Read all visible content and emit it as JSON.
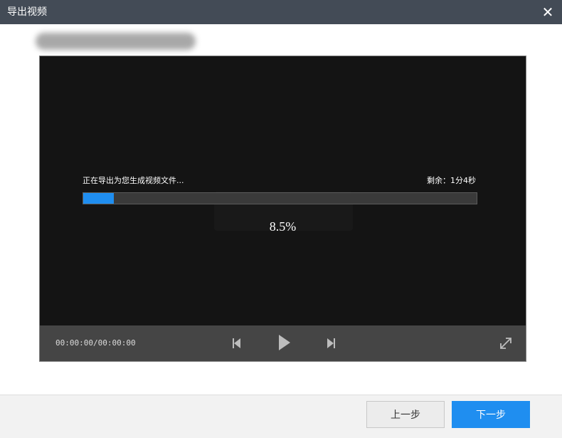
{
  "window": {
    "title": "导出视频"
  },
  "file": {
    "name": ""
  },
  "export": {
    "status_text": "正在导出为您生成视频文件...",
    "remaining_text": "剩余：1分4秒",
    "progress_fraction": 0.077,
    "percent_text": "8.5%"
  },
  "player": {
    "time_text": "00:00:00/00:00:00"
  },
  "footer": {
    "prev_label": "上一步",
    "next_label": "下一步"
  },
  "colors": {
    "titlebar": "#434b56",
    "accent": "#1f8ef0",
    "player_bg": "#141414",
    "controls_bg": "#454545"
  },
  "icons": {
    "close": "close-icon",
    "prev": "skip-previous-icon",
    "play": "play-icon",
    "next": "skip-next-icon",
    "fullscreen": "fullscreen-icon"
  }
}
